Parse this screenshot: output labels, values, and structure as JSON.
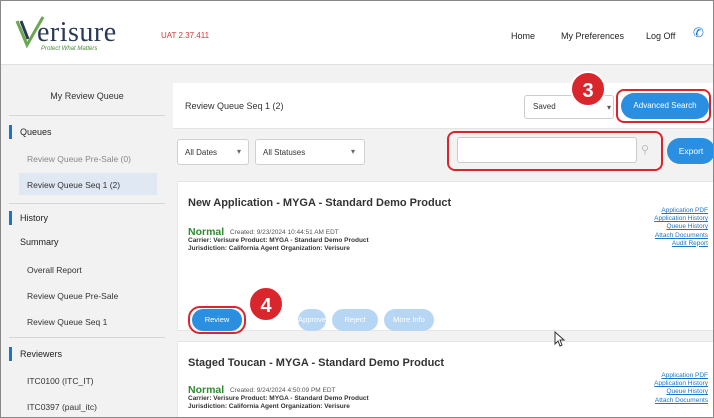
{
  "header": {
    "logo_text": "erisure",
    "logo_tagline": "Protect What Matters",
    "version": "UAT 2.37.411",
    "nav": [
      "Home",
      "My Preferences",
      "Log Off"
    ],
    "phone_icon": "phone-icon"
  },
  "sidebar": {
    "title": "My Review Queue",
    "queues_label": "Queues",
    "queue_items": [
      "Review Queue Pre-Sale (0)",
      "Review Queue Seq 1 (2)"
    ],
    "history_label": "History",
    "summary_label": "Summary",
    "summary_items": [
      "Overall Report",
      "Review Queue Pre-Sale",
      "Review Queue Seq 1"
    ],
    "reviewers_label": "Reviewers",
    "reviewer_items": [
      "ITC0100 (ITC_IT)",
      "ITC0397 (paul_itc)"
    ]
  },
  "main": {
    "queue_title": "Review Queue Seq 1 (2)",
    "saved_select": "Saved",
    "advanced_search_label": "Advanced Search",
    "date_filter": "All Dates",
    "status_filter": "All Statuses",
    "search_value": "",
    "export_label": "Export",
    "cards": [
      {
        "title": "New Application - MYGA - Standard Demo Product",
        "status": "Normal",
        "created": "Created: 9/23/2024 10:44:51 AM EDT",
        "line1": "Carrier: Verisure    Product: MYGA - Standard Demo Product",
        "line2": "Jurisdiction: California    Agent Organization: Verisure",
        "links": [
          "Application PDF",
          "Application History",
          "Queue History",
          "Attach Documents",
          "Audit Report"
        ],
        "actions": [
          "Review",
          "Approve",
          "Reject",
          "More Info"
        ]
      },
      {
        "title": "Staged Toucan - MYGA - Standard Demo Product",
        "status": "Normal",
        "created": "Created: 9/24/2024 4:50:09 PM EDT",
        "line1": "Carrier: Verisure    Product: MYGA - Standard Demo Product",
        "line2": "Jurisdiction: California    Agent Organization: Verisure",
        "links": [
          "Application PDF",
          "Application History",
          "Queue History",
          "Attach Documents"
        ]
      }
    ]
  },
  "annotations": {
    "step3": "3",
    "step4": "4"
  },
  "colors": {
    "accent": "#2a8fe0",
    "highlight": "#d8262c",
    "status_green": "#2e8b2e"
  }
}
